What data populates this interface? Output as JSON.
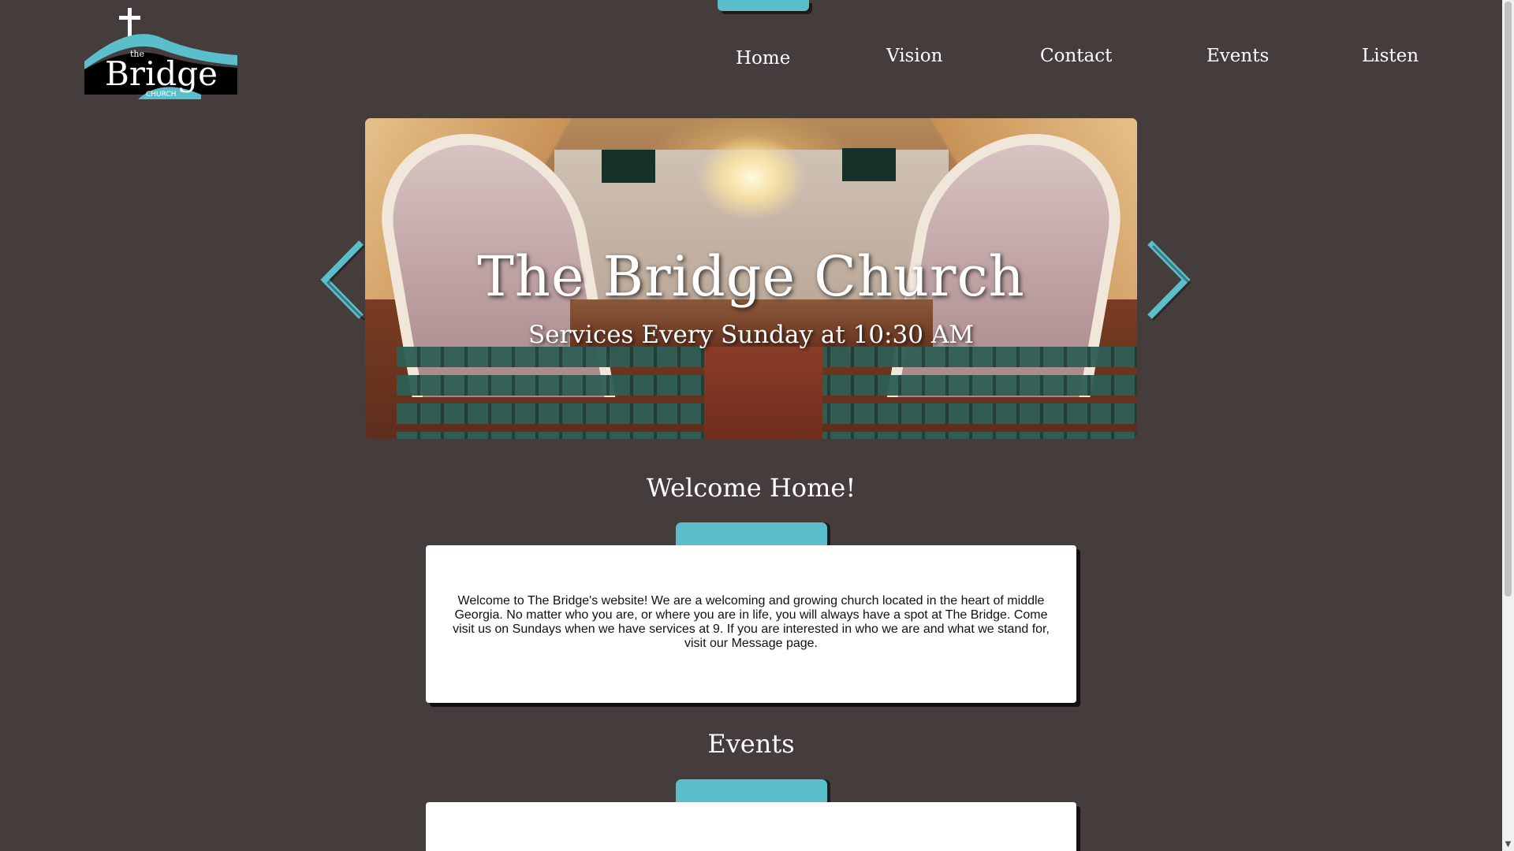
{
  "logo": {
    "word_the": "the",
    "word_main": "Bridge",
    "word_sub": "CHURCH"
  },
  "nav": {
    "items": [
      {
        "label": "Home",
        "active": true
      },
      {
        "label": "Vision"
      },
      {
        "label": "Contact"
      },
      {
        "label": "Events"
      },
      {
        "label": "Listen"
      }
    ]
  },
  "hero": {
    "title": "The Bridge Church",
    "subtitle": "Services Every Sunday at 10:30 AM",
    "prev_icon": "chevron-left-icon",
    "next_icon": "chevron-right-icon"
  },
  "welcome": {
    "title": "Welcome Home!",
    "text": "Welcome to The Bridge's website! We are a welcoming and growing church located in the heart of middle Georgia. No matter who you are, or where you are in life, you will always have a spot at The Bridge. Come visit us on Sundays when we have services at 9. If you are interested in who we are and what we stand for, visit our Message page."
  },
  "events": {
    "title": "Events"
  },
  "colors": {
    "background": "#453d3c",
    "accent": "#5bbfcb",
    "card": "#ffffff"
  }
}
